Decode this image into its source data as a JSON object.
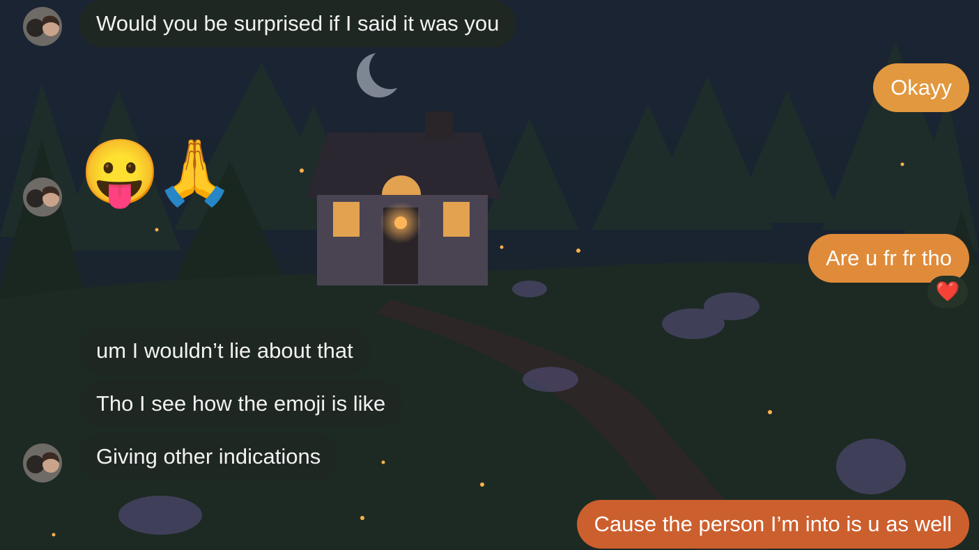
{
  "conversation": {
    "incoming": [
      {
        "text": "Would you be surprised if I said it was you"
      },
      {
        "text": "um I wouldn’t lie about that"
      },
      {
        "text": "Tho I see how the emoji is like"
      },
      {
        "text": "Giving other indications"
      }
    ],
    "emoji_message": {
      "emoji1": "😛",
      "emoji2": "🙏"
    },
    "outgoing": [
      {
        "text": "Okayy",
        "color": "#e2983e"
      },
      {
        "text": "Are u fr fr tho",
        "color": "#e08b3a"
      },
      {
        "text": "Cause the person I’m into is u as well",
        "color": "#cc5f2e"
      }
    ],
    "reaction": {
      "emoji": "❤️"
    }
  },
  "colors": {
    "incoming_bubble": "#1e2722",
    "background_sky": "#1a2333",
    "background_forest": "#1c2a23"
  },
  "icons": {
    "avatar": "contact-avatar-photo",
    "reaction": "heart-reaction-icon"
  }
}
